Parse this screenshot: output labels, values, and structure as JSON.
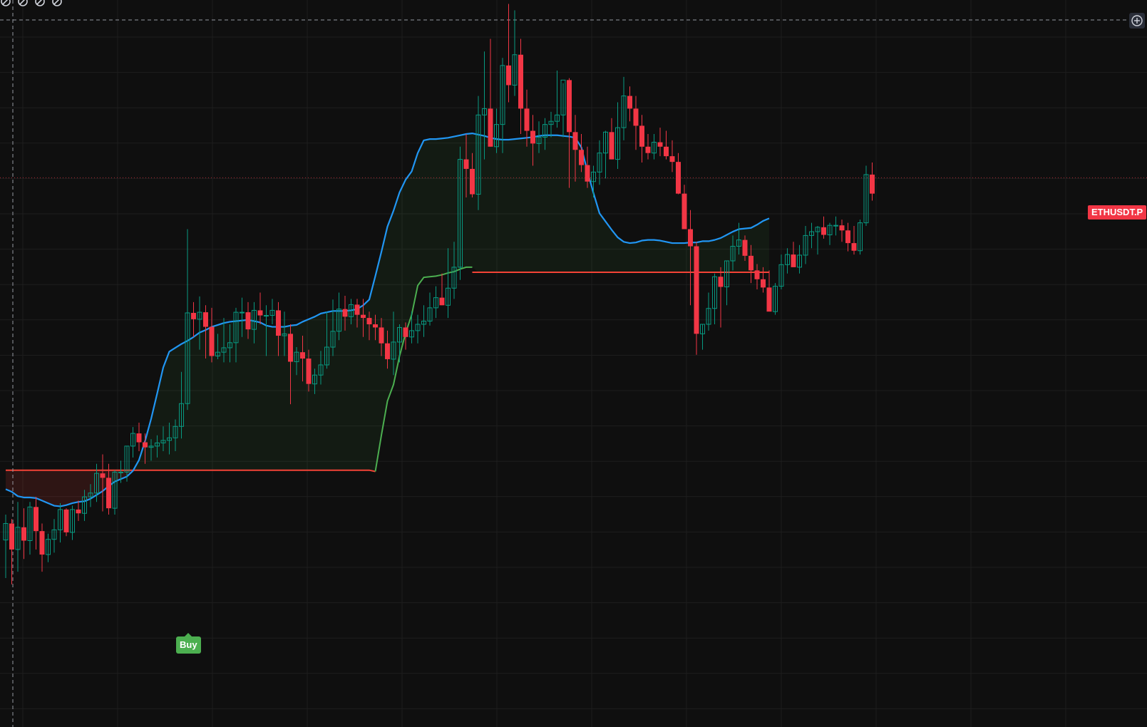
{
  "symbol": {
    "label": "ETHUSDT.P"
  },
  "signal": {
    "buy_label": "Buy"
  },
  "toolbar": {
    "icons": [
      "hide-drawing-icon",
      "hide-drawing-icon",
      "hide-drawing-icon",
      "hide-drawing-icon"
    ],
    "add_icon": "plus-circle-icon"
  },
  "colors": {
    "background": "#0f0f0f",
    "grid": "#1e1e1e",
    "up_candle": "#089981",
    "down_candle": "#f23645",
    "basis_line": "#2196f3",
    "trail_bull": "#4caf50",
    "trail_bear": "#f44336",
    "fill_bull": "rgba(76,175,80,0.08)",
    "fill_bear": "rgba(244,67,54,0.14)",
    "price_line": "#f23645",
    "crosshair": "#9598a1"
  },
  "chart_data": {
    "type": "candlestick",
    "axis_labels_shown": false,
    "grid": true,
    "y_range": [
      0,
      100
    ],
    "last_price": 73.1,
    "candles": [
      [
        16.0,
        20.0,
        10.0,
        18.6
      ],
      [
        18.6,
        19.3,
        9.0,
        14.5
      ],
      [
        14.5,
        22.0,
        11.0,
        18.0
      ],
      [
        18.0,
        21.0,
        13.0,
        15.9
      ],
      [
        15.9,
        22.0,
        13.7,
        21.2
      ],
      [
        21.2,
        22.8,
        14.5,
        17.4
      ],
      [
        17.4,
        18.6,
        11.0,
        13.7
      ],
      [
        13.7,
        17.0,
        12.5,
        16.1
      ],
      [
        16.1,
        19.3,
        14.0,
        17.6
      ],
      [
        17.6,
        21.8,
        15.6,
        20.8
      ],
      [
        20.8,
        21.0,
        16.6,
        17.2
      ],
      [
        17.2,
        21.4,
        16.0,
        20.8
      ],
      [
        20.8,
        22.2,
        19.0,
        20.2
      ],
      [
        20.2,
        23.9,
        19.0,
        22.8
      ],
      [
        22.8,
        24.8,
        21.2,
        23.4
      ],
      [
        23.4,
        28.0,
        22.0,
        26.5
      ],
      [
        26.5,
        29.5,
        20.5,
        25.8
      ],
      [
        25.8,
        28.0,
        20.0,
        21.0
      ],
      [
        21.0,
        27.0,
        20.0,
        26.7
      ],
      [
        26.7,
        28.5,
        25.0,
        26.7
      ],
      [
        26.7,
        30.8,
        25.2,
        30.8
      ],
      [
        30.8,
        33.8,
        29.0,
        32.8
      ],
      [
        32.8,
        34.5,
        30.0,
        31.4
      ],
      [
        31.4,
        32.8,
        28.0,
        30.6
      ],
      [
        30.6,
        31.9,
        28.5,
        30.8
      ],
      [
        30.8,
        32.5,
        29.0,
        31.3
      ],
      [
        31.3,
        33.9,
        30.0,
        31.7
      ],
      [
        31.7,
        34.5,
        29.5,
        32.1
      ],
      [
        32.1,
        35.0,
        30.0,
        33.9
      ],
      [
        33.9,
        42.5,
        32.0,
        37.5
      ],
      [
        37.5,
        65.0,
        36.5,
        51.8
      ],
      [
        51.8,
        53.5,
        48.0,
        50.8
      ],
      [
        50.8,
        54.4,
        46.0,
        51.9
      ],
      [
        51.9,
        53.0,
        44.6,
        49.6
      ],
      [
        49.6,
        52.6,
        44.0,
        45.0
      ],
      [
        45.0,
        48.5,
        44.5,
        45.6
      ],
      [
        45.6,
        51.0,
        44.0,
        46.3
      ],
      [
        46.3,
        50.0,
        44.0,
        47.1
      ],
      [
        47.1,
        52.6,
        44.0,
        51.9
      ],
      [
        51.9,
        54.2,
        48.0,
        51.9
      ],
      [
        51.9,
        53.5,
        47.7,
        49.2
      ],
      [
        49.2,
        53.5,
        47.0,
        52.2
      ],
      [
        52.2,
        55.0,
        50.0,
        51.4
      ],
      [
        51.4,
        53.0,
        45.0,
        51.4
      ],
      [
        51.4,
        54.0,
        50.0,
        52.2
      ],
      [
        52.2,
        53.5,
        45.0,
        48.2
      ],
      [
        48.2,
        52.0,
        45.0,
        48.5
      ],
      [
        48.5,
        50.0,
        37.4,
        44.1
      ],
      [
        44.1,
        46.4,
        42.0,
        45.6
      ],
      [
        45.6,
        48.2,
        41.0,
        44.6
      ],
      [
        44.6,
        46.0,
        39.4,
        40.6
      ],
      [
        40.6,
        43.0,
        39.0,
        42.0
      ],
      [
        42.0,
        45.8,
        40.5,
        43.6
      ],
      [
        43.6,
        52.0,
        43.0,
        46.4
      ],
      [
        46.4,
        53.9,
        45.0,
        48.9
      ],
      [
        48.9,
        55.0,
        47.5,
        52.4
      ],
      [
        52.4,
        54.5,
        49.0,
        51.2
      ],
      [
        51.2,
        54.0,
        50.0,
        53.1
      ],
      [
        53.1,
        54.0,
        49.5,
        51.5
      ],
      [
        51.5,
        54.0,
        48.0,
        51.0
      ],
      [
        51.0,
        52.0,
        47.5,
        50.0
      ],
      [
        50.0,
        51.5,
        47.5,
        49.5
      ],
      [
        49.5,
        51.0,
        45.0,
        47.0
      ],
      [
        47.0,
        49.0,
        43.0,
        44.5
      ],
      [
        44.5,
        52.0,
        42.0,
        47.2
      ],
      [
        47.2,
        50.0,
        44.0,
        49.5
      ],
      [
        49.5,
        50.3,
        46.0,
        48.0
      ],
      [
        48.0,
        52.0,
        47.0,
        49.0
      ],
      [
        49.0,
        51.5,
        47.0,
        50.0
      ],
      [
        50.0,
        53.0,
        48.0,
        50.5
      ],
      [
        50.5,
        55.0,
        49.8,
        52.6
      ],
      [
        52.6,
        56.0,
        51.0,
        54.2
      ],
      [
        54.2,
        58.0,
        53.0,
        53.0
      ],
      [
        53.0,
        62.0,
        51.0,
        55.7
      ],
      [
        55.7,
        63.0,
        54.0,
        59.0
      ],
      [
        59.0,
        78.0,
        57.0,
        76.0
      ],
      [
        76.0,
        80.0,
        70.0,
        74.5
      ],
      [
        74.5,
        77.0,
        70.0,
        70.5
      ],
      [
        70.5,
        86.0,
        68.0,
        83.0
      ],
      [
        83.0,
        93.0,
        76.0,
        84.0
      ],
      [
        84.0,
        95.0,
        78.0,
        78.0
      ],
      [
        78.0,
        84.0,
        77.0,
        81.5
      ],
      [
        81.5,
        92.0,
        77.0,
        90.8
      ],
      [
        90.8,
        100.5,
        85.0,
        87.7
      ],
      [
        87.7,
        99.5,
        86.0,
        92.5
      ],
      [
        92.5,
        95.0,
        80.0,
        84.0
      ],
      [
        84.0,
        87.0,
        78.0,
        80.5
      ],
      [
        80.5,
        83.0,
        75.0,
        78.5
      ],
      [
        78.5,
        82.0,
        77.0,
        79.5
      ],
      [
        79.5,
        82.5,
        77.5,
        81.5
      ],
      [
        81.5,
        83.5,
        79.5,
        82.0
      ],
      [
        82.0,
        90.0,
        81.0,
        83.0
      ],
      [
        83.0,
        88.0,
        79.5,
        88.5
      ],
      [
        88.5,
        88.8,
        71.5,
        80.3
      ],
      [
        80.3,
        83.0,
        72.5,
        77.5
      ],
      [
        77.5,
        80.0,
        74.0,
        75.1
      ],
      [
        75.1,
        78.0,
        71.5,
        72.5
      ],
      [
        72.5,
        75.0,
        70.0,
        74.0
      ],
      [
        74.0,
        79.0,
        72.0,
        77.0
      ],
      [
        77.0,
        80.5,
        73.0,
        80.3
      ],
      [
        80.3,
        82.5,
        76.0,
        76.0
      ],
      [
        76.0,
        85.0,
        74.5,
        81.0
      ],
      [
        81.0,
        89.0,
        79.0,
        86.0
      ],
      [
        86.0,
        87.5,
        82.0,
        84.0
      ],
      [
        84.0,
        86.0,
        77.5,
        81.3
      ],
      [
        81.3,
        83.0,
        75.5,
        78.0
      ],
      [
        78.0,
        80.0,
        76.0,
        77.0
      ],
      [
        77.0,
        80.0,
        76.0,
        78.7
      ],
      [
        78.7,
        81.0,
        76.5,
        78.0
      ],
      [
        78.0,
        80.5,
        76.0,
        76.5
      ],
      [
        76.5,
        79.0,
        74.0,
        75.6
      ],
      [
        75.6,
        77.0,
        70.5,
        70.6
      ],
      [
        70.6,
        72.0,
        66.0,
        65.0
      ],
      [
        65.0,
        68.0,
        53.0,
        62.3
      ],
      [
        62.3,
        63.0,
        45.2,
        48.5
      ],
      [
        48.5,
        50.0,
        46.0,
        50.0
      ],
      [
        50.0,
        55.0,
        49.0,
        52.5
      ],
      [
        52.5,
        58.0,
        50.0,
        57.5
      ],
      [
        57.5,
        59.0,
        49.5,
        55.9
      ],
      [
        55.9,
        60.0,
        53.0,
        60.0
      ],
      [
        60.0,
        64.0,
        58.5,
        62.3
      ],
      [
        62.3,
        66.0,
        61.0,
        63.3
      ],
      [
        63.3,
        64.0,
        60.0,
        60.8
      ],
      [
        60.8,
        62.5,
        56.5,
        58.5
      ],
      [
        58.5,
        59.5,
        55.5,
        57.1
      ],
      [
        57.1,
        59.0,
        55.0,
        55.8
      ],
      [
        55.8,
        58.5,
        54.5,
        52.0
      ],
      [
        52.0,
        56.5,
        51.5,
        56.0
      ],
      [
        56.0,
        61.0,
        55.5,
        59.4
      ],
      [
        59.4,
        62.0,
        58.0,
        61.0
      ],
      [
        61.0,
        63.0,
        59.5,
        59.0
      ],
      [
        59.0,
        62.5,
        58.0,
        60.9
      ],
      [
        60.9,
        65.5,
        59.5,
        64.0
      ],
      [
        64.0,
        66.0,
        62.0,
        64.6
      ],
      [
        64.6,
        65.5,
        61.0,
        65.3
      ],
      [
        65.3,
        67.0,
        63.5,
        64.1
      ],
      [
        64.1,
        66.0,
        62.5,
        65.6
      ],
      [
        65.6,
        67.0,
        64.0,
        65.6
      ],
      [
        65.6,
        66.5,
        63.0,
        64.8
      ],
      [
        64.8,
        66.0,
        61.5,
        62.8
      ],
      [
        62.8,
        65.5,
        61.0,
        61.6
      ],
      [
        61.6,
        66.5,
        61.0,
        66.0
      ],
      [
        66.0,
        75.0,
        65.5,
        73.6
      ],
      [
        73.6,
        75.5,
        69.5,
        70.6
      ]
    ],
    "supertrend_basis": [
      24.0,
      23.6,
      22.9,
      22.7,
      22.7,
      22.6,
      22.2,
      21.8,
      21.4,
      21.3,
      21.5,
      21.8,
      22.0,
      22.1,
      22.5,
      23.1,
      23.7,
      24.5,
      25.2,
      25.6,
      26.0,
      26.9,
      28.6,
      31.6,
      35.1,
      39.1,
      43.2,
      45.7,
      46.3,
      46.9,
      47.4,
      48.0,
      48.7,
      49.1,
      49.6,
      49.9,
      50.2,
      50.4,
      50.5,
      50.6,
      50.7,
      50.5,
      50.3,
      49.8,
      49.6,
      49.6,
      49.6,
      49.8,
      49.9,
      50.4,
      50.8,
      51.2,
      51.7,
      51.9,
      52.1,
      52.1,
      52.1,
      52.2,
      52.4,
      53.0,
      53.9,
      57.6,
      61.4,
      65.4,
      67.9,
      70.8,
      72.8,
      74.1,
      77.0,
      79.0,
      79.2,
      79.2,
      79.3,
      79.4,
      79.6,
      79.8,
      80.0,
      80.1,
      79.9,
      79.7,
      79.4,
      79.2,
      79.1,
      79.1,
      79.2,
      79.3,
      79.4,
      79.5,
      79.7,
      79.8,
      79.8,
      79.8,
      79.7,
      79.6,
      79.4,
      77.9,
      74.1,
      70.7,
      67.5,
      66.2,
      64.9,
      63.7,
      63.0,
      62.8,
      62.9,
      63.2,
      63.3,
      63.3,
      63.2,
      63.0,
      62.8,
      62.8,
      62.8,
      62.9,
      62.9,
      63.1,
      63.1,
      63.3,
      63.6,
      64.1,
      64.6,
      65.0,
      65.1,
      65.2,
      65.7,
      66.3,
      66.7
    ],
    "supertrend_trail_bear": [
      27.0,
      27.0,
      27.0,
      27.0,
      27.0,
      27.0,
      27.0,
      27.0,
      27.0,
      27.0,
      27.0,
      27.0,
      27.0,
      27.0,
      27.0,
      27.0,
      27.0,
      27.0,
      27.0,
      27.0,
      27.0,
      27.0
    ],
    "supertrend_trail_bull_segment1": [
      27.0,
      27.0,
      27.0,
      27.0,
      27.0,
      27.0,
      27.0,
      27.0,
      27.0,
      27.0,
      27.0,
      27.0,
      27.0,
      27.0,
      27.0,
      27.0,
      27.0,
      27.0,
      27.0,
      27.0,
      27.0,
      27.0,
      27.0,
      27.0,
      27.0,
      27.0,
      27.0,
      27.0,
      27.0,
      27.0,
      27.0,
      27.0,
      27.0,
      27.0,
      27.0,
      27.0,
      27.0,
      27.0,
      27.0,
      27.0,
      27.0,
      27.0,
      27.0,
      27.0,
      27.0,
      27.0,
      27.0,
      27.0,
      27.0,
      27.0,
      27.0,
      27.0,
      27.0,
      27.0,
      27.0,
      27.0,
      27.0,
      27.0,
      27.0,
      27.0,
      27.0,
      26.8,
      32.5,
      37.9,
      40.5,
      45.0,
      48.6,
      51.5,
      56.1,
      57.4,
      57.5,
      57.6,
      57.8,
      58.1,
      58.3,
      58.7,
      59.0,
      59.0
    ],
    "supertrend_trail_flat": 58.2,
    "price_line_value": 73.1,
    "buy_signal_index": 30
  }
}
